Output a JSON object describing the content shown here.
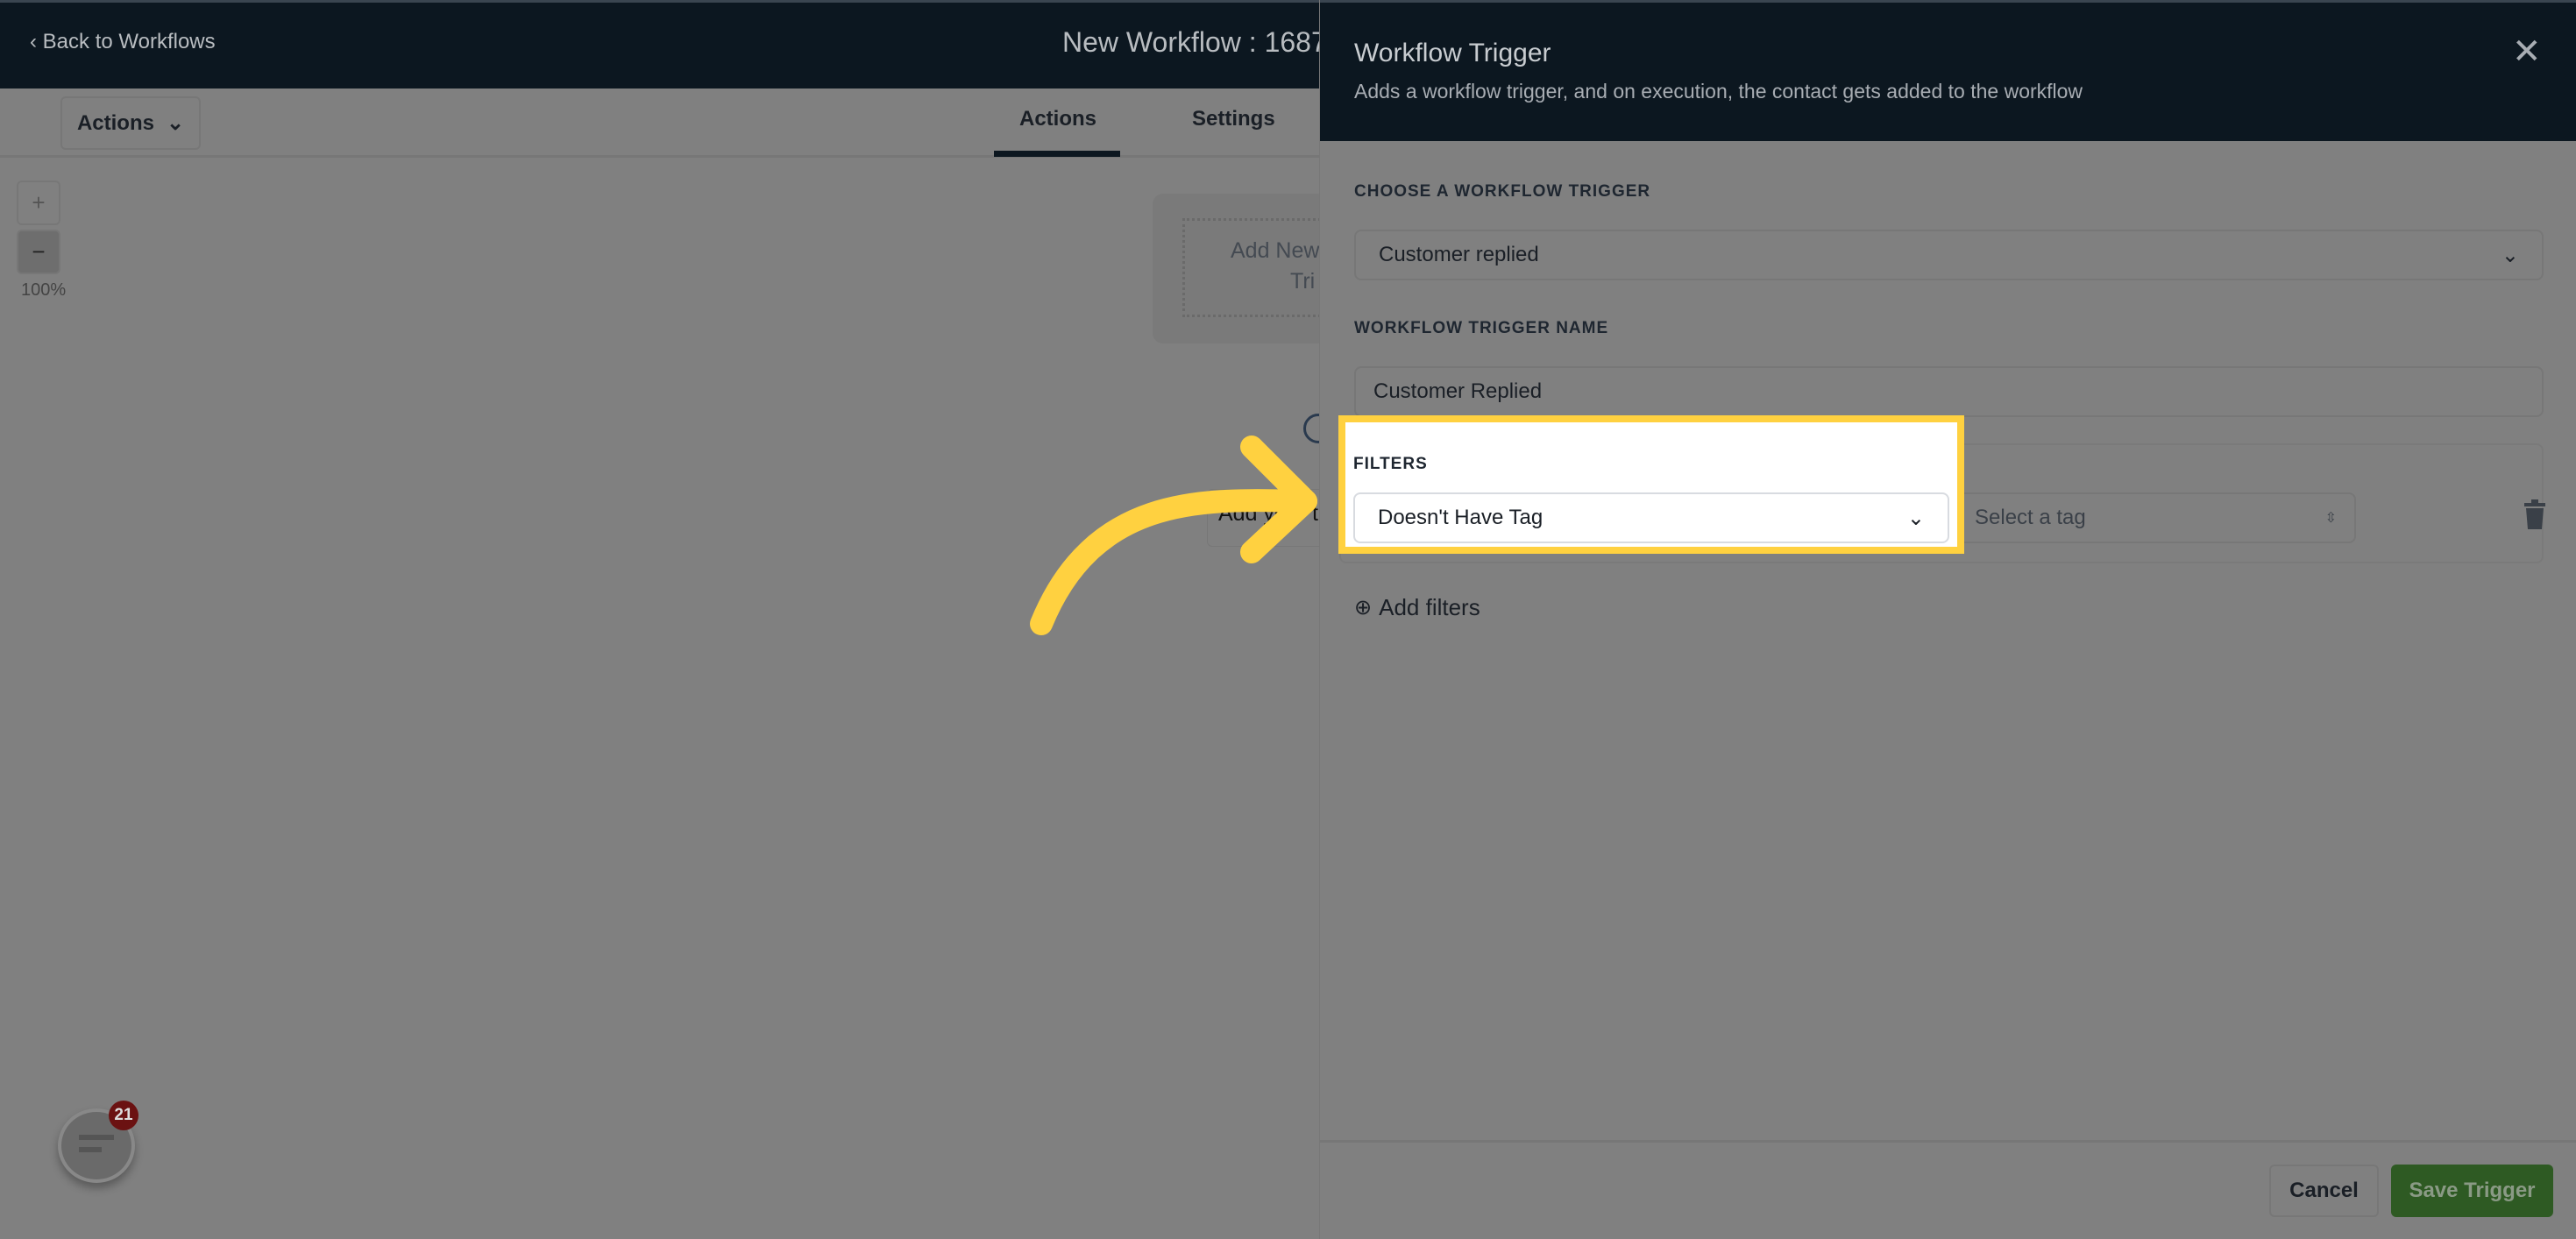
{
  "header": {
    "back_label": "Back to Workflows",
    "title": "New Workflow : 1687"
  },
  "toolbar": {
    "actions_label": "Actions",
    "tabs": [
      {
        "label": "Actions",
        "active": true
      },
      {
        "label": "Settings",
        "active": false
      }
    ]
  },
  "zoom": {
    "plus": "+",
    "minus": "−",
    "level": "100%"
  },
  "canvas": {
    "card_line1": "Add New",
    "card_line2": "Tri",
    "add_text": "Add your t"
  },
  "panel": {
    "title": "Workflow Trigger",
    "subtitle": "Adds a workflow trigger, and on execution, the contact gets added to the workflow",
    "trigger_label": "CHOOSE A WORKFLOW TRIGGER",
    "trigger_value": "Customer replied",
    "name_label": "WORKFLOW TRIGGER NAME",
    "name_value": "Customer Replied",
    "filters_label": "FILTERS",
    "filter_value": "Doesn't Have Tag",
    "tag_placeholder": "Select a tag",
    "add_filters": "Add filters",
    "cancel": "Cancel",
    "save": "Save Trigger"
  },
  "chat": {
    "badge": "21"
  },
  "colors": {
    "highlight": "#ffd140",
    "save": "#2e5a23",
    "header": "#0c1720"
  }
}
